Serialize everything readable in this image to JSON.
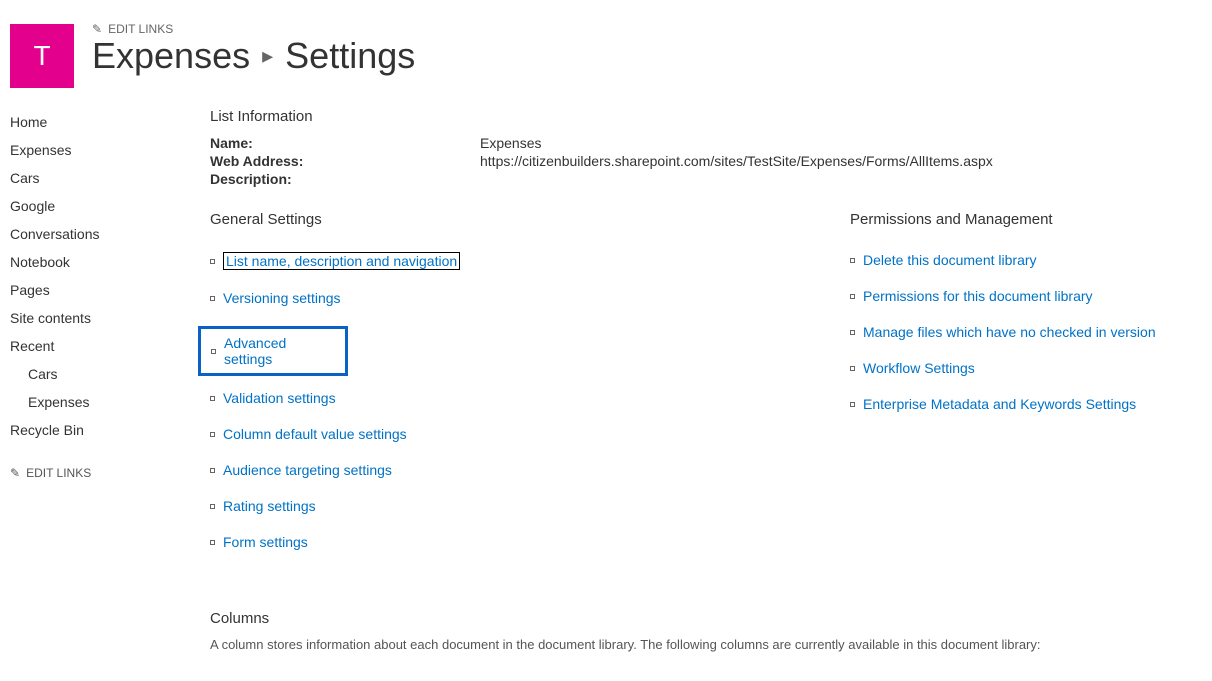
{
  "header": {
    "logo_letter": "T",
    "edit_links_label": "EDIT LINKS",
    "breadcrumb_site": "Expenses",
    "breadcrumb_page": "Settings"
  },
  "left_nav": {
    "items": [
      {
        "label": "Home",
        "sub": false
      },
      {
        "label": "Expenses",
        "sub": false
      },
      {
        "label": "Cars",
        "sub": false
      },
      {
        "label": "Google",
        "sub": false
      },
      {
        "label": "Conversations",
        "sub": false
      },
      {
        "label": "Notebook",
        "sub": false
      },
      {
        "label": "Pages",
        "sub": false
      },
      {
        "label": "Site contents",
        "sub": false
      },
      {
        "label": "Recent",
        "sub": false
      },
      {
        "label": "Cars",
        "sub": true
      },
      {
        "label": "Expenses",
        "sub": true
      },
      {
        "label": "Recycle Bin",
        "sub": false
      }
    ],
    "edit_links_label": "EDIT LINKS"
  },
  "list_info": {
    "heading": "List Information",
    "name_label": "Name:",
    "name_value": "Expenses",
    "web_label": "Web Address:",
    "web_value": "https://citizenbuilders.sharepoint.com/sites/TestSite/Expenses/Forms/AllItems.aspx",
    "desc_label": "Description:",
    "desc_value": ""
  },
  "general_settings": {
    "heading": "General Settings",
    "links": [
      "List name, description and navigation",
      "Versioning settings",
      "Advanced settings",
      "Validation settings",
      "Column default value settings",
      "Audience targeting settings",
      "Rating settings",
      "Form settings"
    ]
  },
  "permissions": {
    "heading": "Permissions and Management",
    "links": [
      "Delete this document library",
      "Permissions for this document library",
      "Manage files which have no checked in version",
      "Workflow Settings",
      "Enterprise Metadata and Keywords Settings"
    ]
  },
  "columns": {
    "heading": "Columns",
    "description": "A column stores information about each document in the document library. The following columns are currently available in this document library:"
  }
}
